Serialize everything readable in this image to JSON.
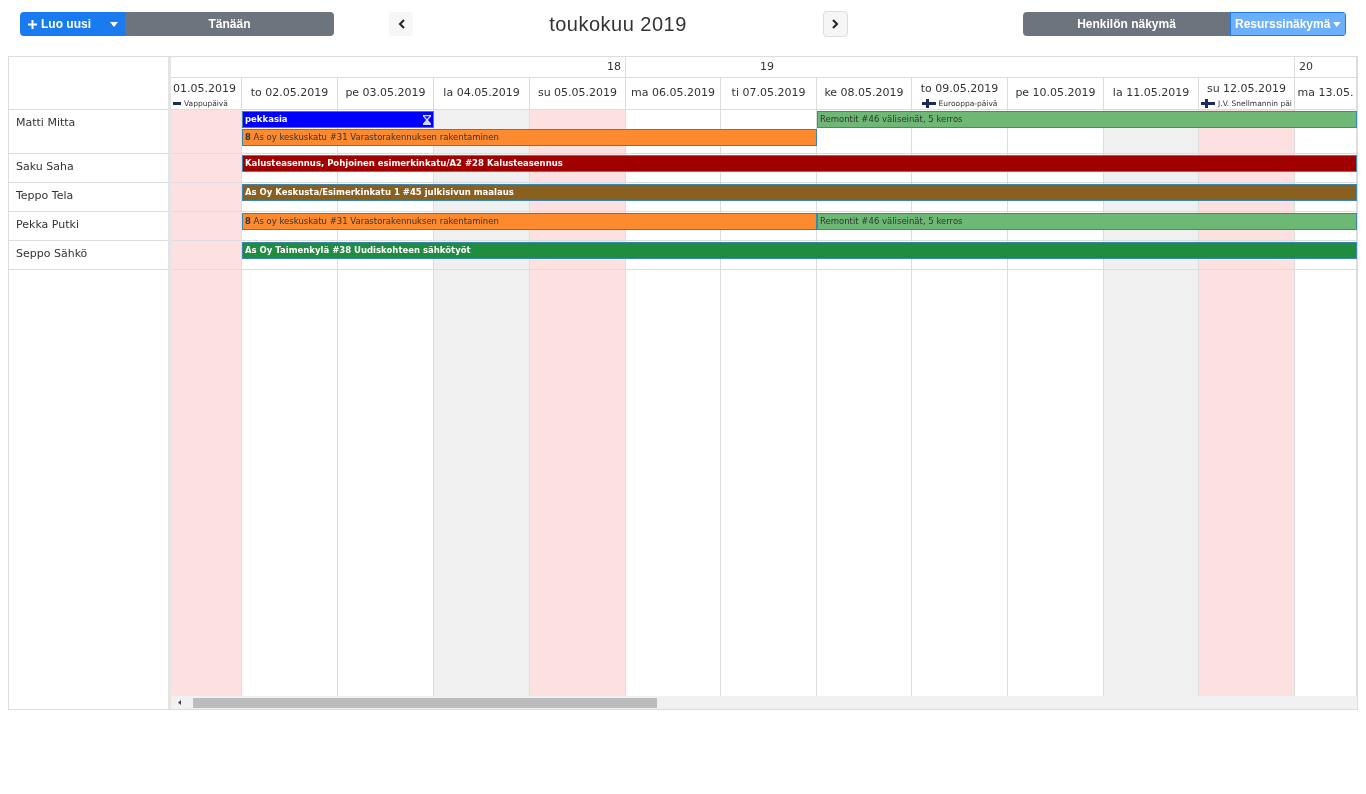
{
  "toolbar": {
    "create_button": "Luo uusi",
    "today_button": "Tänään",
    "title": "toukokuu 2019",
    "views": [
      {
        "label": "Henkilön näkymä",
        "selected": false,
        "dropdown": false
      },
      {
        "label": "Resurssinäkymä",
        "selected": true,
        "dropdown": true
      }
    ]
  },
  "weeks": [
    {
      "label": "18"
    },
    {
      "label": "19"
    },
    {
      "label": "20"
    }
  ],
  "days": [
    {
      "label": "01.05.2019",
      "kind": "holiday",
      "holiday": {
        "name": "Vappupäivä",
        "kind": "dash"
      }
    },
    {
      "label": "to 02.05.2019",
      "kind": "weekday"
    },
    {
      "label": "pe 03.05.2019",
      "kind": "weekday"
    },
    {
      "label": "la 04.05.2019",
      "kind": "saturday"
    },
    {
      "label": "su 05.05.2019",
      "kind": "holiday"
    },
    {
      "label": "ma 06.05.2019",
      "kind": "weekday"
    },
    {
      "label": "ti 07.05.2019",
      "kind": "weekday"
    },
    {
      "label": "ke 08.05.2019",
      "kind": "weekday"
    },
    {
      "label": "to 09.05.2019",
      "kind": "weekday",
      "holiday": {
        "name": "Eurooppa-päivä",
        "kind": "flag"
      }
    },
    {
      "label": "pe 10.05.2019",
      "kind": "weekday"
    },
    {
      "label": "la 11.05.2019",
      "kind": "saturday"
    },
    {
      "label": "su 12.05.2019",
      "kind": "holiday",
      "holiday": {
        "name": "J.V. Snellmannin päi",
        "kind": "flag"
      }
    },
    {
      "label": "ma 13.05.",
      "kind": "weekday"
    }
  ],
  "resources": [
    {
      "name": "Matti Mitta",
      "events": [
        {
          "title": "pekkasia",
          "kind": "absence",
          "color": "#0000ff"
        },
        {
          "title": "Remontit #46 väliseinät, 5 kerros",
          "kind": "task",
          "color": "#6cb874"
        },
        {
          "title": "**8** As oy keskuskatu #31 Varastorakennuksen rakentaminen",
          "kind": "task",
          "color": "#fd8a2e"
        }
      ]
    },
    {
      "name": "Saku Saha",
      "events": [
        {
          "title": "Kalusteasennus, Pohjoinen esimerkinkatu/A2 #28 Kalusteasennus",
          "kind": "task",
          "color": "#a00000"
        }
      ]
    },
    {
      "name": "Teppo Tela",
      "events": [
        {
          "title": "As Oy Keskusta/Esimerkinkatu 1 #45 julkisivun maalaus",
          "kind": "task",
          "color": "#8a6020"
        }
      ]
    },
    {
      "name": "Pekka Putki",
      "events": [
        {
          "title": "**8** As oy keskuskatu #31 Varastorakennuksen rakentaminen",
          "kind": "task",
          "color": "#fd8a2e"
        },
        {
          "title": "Remontit #46 väliseinät, 5 kerros",
          "kind": "task",
          "color": "#6cb874"
        }
      ]
    },
    {
      "name": "Seppo Sähkö",
      "events": [
        {
          "title": "As Oy Taimenkylä #38 Uudiskohteen sähkötyöt",
          "kind": "task",
          "color": "#1f8c40"
        }
      ]
    }
  ]
}
